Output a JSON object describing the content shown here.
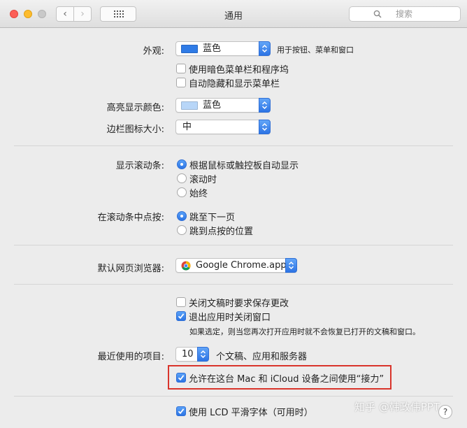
{
  "window": {
    "title": "通用",
    "search_placeholder": "搜索",
    "nav_back": "‹",
    "nav_forward": "›"
  },
  "appearance": {
    "label": "外观:",
    "value": "蓝色",
    "swatch_color": "#2f7be6",
    "note": "用于按钮、菜单和窗口",
    "dark_menu_bar": {
      "label": "使用暗色菜单栏和程序坞",
      "checked": false
    },
    "auto_hide_menu_bar": {
      "label": "自动隐藏和显示菜单栏",
      "checked": false
    }
  },
  "highlight_color": {
    "label": "高亮显示颜色:",
    "value": "蓝色",
    "swatch_color": "#b8d6f8"
  },
  "sidebar_icon_size": {
    "label": "边栏图标大小:",
    "value": "中"
  },
  "scroll_bars": {
    "label": "显示滚动条:",
    "options": [
      {
        "label": "根据鼠标或触控板自动显示",
        "selected": true
      },
      {
        "label": "滚动时",
        "selected": false
      },
      {
        "label": "始终",
        "selected": false
      }
    ]
  },
  "click_in_scroll_bar": {
    "label": "在滚动条中点按:",
    "options": [
      {
        "label": "跳至下一页",
        "selected": true
      },
      {
        "label": "跳到点按的位置",
        "selected": false
      }
    ]
  },
  "default_browser": {
    "label": "默认网页浏览器:",
    "value": "Google Chrome.app"
  },
  "documents": {
    "ask_keep_changes": {
      "label": "关闭文稿时要求保存更改",
      "checked": false
    },
    "close_windows_on_quit": {
      "label": "退出应用时关闭窗口",
      "checked": true
    },
    "note": "如果选定，则当您再次打开应用时就不会恢复已打开的文稿和窗口。"
  },
  "recent_items": {
    "label": "最近使用的项目:",
    "value": "10",
    "suffix": "个文稿、应用和服务器"
  },
  "handoff": {
    "label": "允许在这台 Mac 和 iCloud 设备之间使用“接力”",
    "checked": true
  },
  "lcd_font": {
    "label": "使用 LCD 平滑字体（可用时）",
    "checked": true
  },
  "help_label": "?",
  "watermark": "知乎 @韩政伟PPT",
  "colors": {
    "accent": "#2c74e4",
    "highlight_border": "#d9342b",
    "window_bg": "#ececec"
  }
}
